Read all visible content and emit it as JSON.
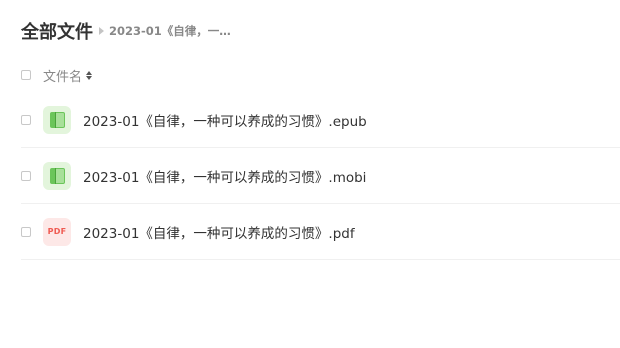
{
  "header": {
    "title": "全部文件",
    "breadcrumb": "2023-01《自律，一种..."
  },
  "columns": {
    "name_label": "文件名"
  },
  "files": [
    {
      "name": "2023-01《自律，一种可以养成的习惯》.epub",
      "icon": "ebook-icon"
    },
    {
      "name": "2023-01《自律，一种可以养成的习惯》.mobi",
      "icon": "ebook-icon"
    },
    {
      "name": "2023-01《自律，一种可以养成的习惯》.pdf",
      "icon": "pdf-icon",
      "icon_text": "PDF"
    }
  ],
  "colors": {
    "ebook_icon_bg": "#e3f5dc",
    "ebook_icon_fg": "#6bc55a",
    "pdf_icon_bg": "#fde8e7",
    "pdf_icon_fg": "#ef5b52"
  }
}
